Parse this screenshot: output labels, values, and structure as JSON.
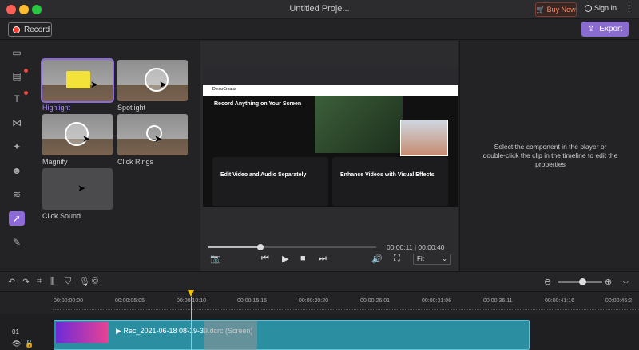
{
  "window": {
    "title": "Untitled Proje..."
  },
  "header": {
    "buy_label": "Buy Now",
    "signin_label": "Sign In"
  },
  "toolbar": {
    "record_label": "Record",
    "export_label": "Export"
  },
  "effects": [
    {
      "label": "Highlight",
      "selected": true
    },
    {
      "label": "Spotlight",
      "selected": false
    },
    {
      "label": "Magnify",
      "selected": false
    },
    {
      "label": "Click Rings",
      "selected": false
    },
    {
      "label": "Click Sound",
      "selected": false
    }
  ],
  "video": {
    "headline": "Record Anything on Your Screen",
    "card1": "Edit Video and Audio Separately",
    "card2": "Enhance Videos with Visual Effects",
    "brand": "DemoCreator"
  },
  "player": {
    "timecode": "00:00:11 | 00:00:40",
    "fit_label": "Fit",
    "progress": 0.31
  },
  "properties": {
    "message": "Select the component in the player or double-click the clip in the timeline to edit the properties"
  },
  "timeline": {
    "ticks": [
      "00:00:00:00",
      "00:00:05:05",
      "00:00:10:10",
      "00:00:15:15",
      "00:00:20:20",
      "00:00:26:01",
      "00:00:31:06",
      "00:00:36:11",
      "00:00:41:16",
      "00:00:46:2"
    ],
    "track_number": "01",
    "clip_label": "Rec_2021-06-18 08-19-39.dcrc (Screen)",
    "zoom": 0.55
  },
  "colors": {
    "accent": "#8d6ad8",
    "playhead": "#f2c200",
    "clip": "#2b8ea1",
    "record": "#ff3b30"
  }
}
